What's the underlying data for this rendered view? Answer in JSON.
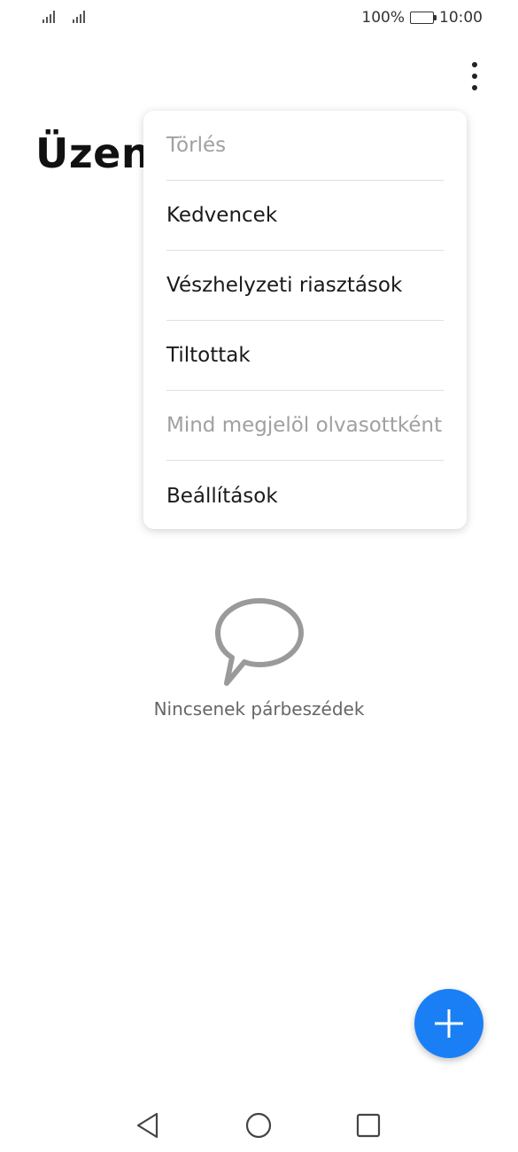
{
  "status_bar": {
    "battery_percent": "100%",
    "time": "10:00",
    "battery_level": 1.0
  },
  "header": {
    "title": "Üzene"
  },
  "menu": {
    "items": [
      {
        "label": "Törlés",
        "enabled": false
      },
      {
        "label": "Kedvencek",
        "enabled": true
      },
      {
        "label": "Vészhelyzeti riasztások",
        "enabled": true
      },
      {
        "label": "Tiltottak",
        "enabled": true
      },
      {
        "label": "Mind megjelöl olvasottként",
        "enabled": false
      },
      {
        "label": "Beállítások",
        "enabled": true
      }
    ]
  },
  "empty_state": {
    "icon": "speech-bubble-icon",
    "text": "Nincsenek párbeszédek"
  },
  "fab": {
    "icon": "plus-icon",
    "color": "#1a7ff5"
  },
  "nav": {
    "back_icon": "back-triangle-icon",
    "home_icon": "home-circle-icon",
    "recent_icon": "recent-square-icon"
  }
}
